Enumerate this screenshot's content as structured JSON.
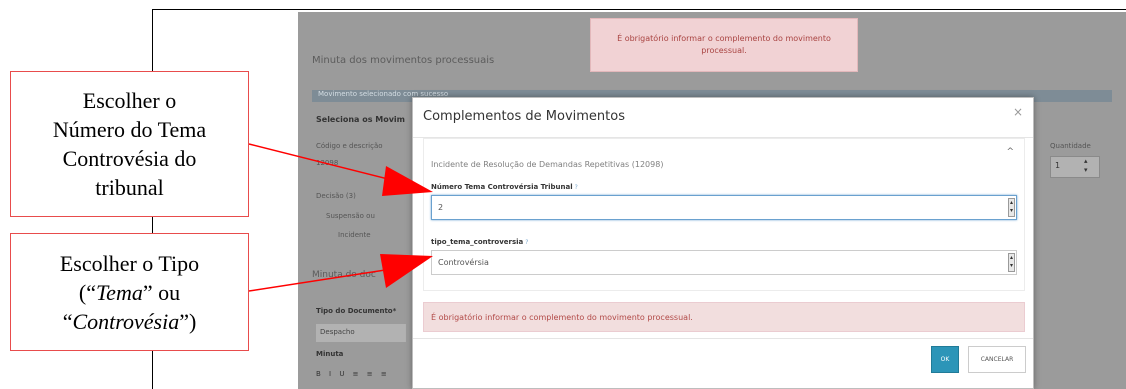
{
  "toast": {
    "message": "É obrigatório informar o complemento do movimento processual."
  },
  "background": {
    "section_title": "Minuta dos movimentos processuais",
    "info_strip": "Movimento selecionado com sucesso",
    "select_label": "Seleciona os Movim",
    "code_label": "Código e descrição",
    "code_value": "12098",
    "tree": [
      "Decisão (3)",
      "Suspensão ou",
      "Incidente"
    ],
    "quantity_label": "Quantidade",
    "quantity_value": "1",
    "minuta_doc_title": "Minuta do doc",
    "doc_type_label": "Tipo do Documento*",
    "doc_type_value": "Despacho",
    "minuta_label": "Minuta",
    "editor_toolbar": "B I U ≡ ≡ ≡"
  },
  "modal": {
    "title": "Complementos de Movimentos",
    "close_glyph": "×",
    "panel_title": "Incidente de Resolução de Demandas Repetitivas (12098)",
    "panel_collapse_glyph": "^",
    "field1": {
      "label": "Número Tema Controvérsia Tribunal",
      "help": "?",
      "value": "2"
    },
    "field2": {
      "label": "tipo_tema_controversia",
      "help": "?",
      "value": "Controvérsia"
    },
    "alert": "É obrigatório informar o complemento do movimento processual.",
    "ok_label": "OK",
    "cancel_label": "CANCELAR"
  },
  "callouts": {
    "first": {
      "lines": [
        "Escolher o",
        "Número do Tema",
        "Controvésia do",
        "tribunal"
      ]
    },
    "second": {
      "line1": "Escolher o Tipo",
      "open": "(“",
      "tema": "Tema",
      "middle": "” ou",
      "open2": "“",
      "controversia": "Controvésia",
      "close": "”)"
    }
  },
  "colors": {
    "arrow": "#ff0000",
    "callout_border": "#e84c4c",
    "ok_button": "#2c95b8",
    "alert_bg": "#f2dede"
  }
}
